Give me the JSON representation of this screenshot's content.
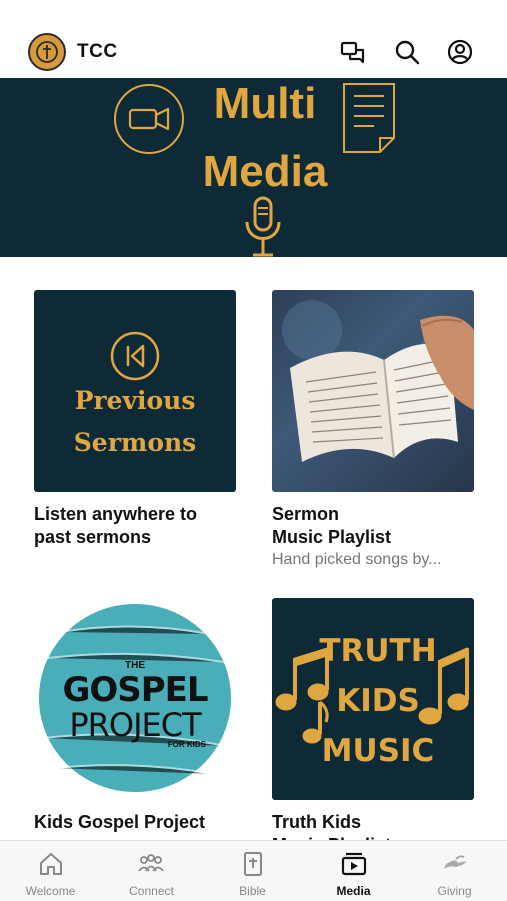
{
  "header": {
    "title": "TCC"
  },
  "banner": {
    "line1": "Multi",
    "line2": "Media"
  },
  "cards": [
    {
      "thumb_line1": "Previous",
      "thumb_line2": "Sermons",
      "title": "Listen anywhere to past sermons",
      "subtitle": ""
    },
    {
      "title_line1": "Sermon",
      "title_line2": "Music Playlist",
      "subtitle": "Hand picked songs by..."
    },
    {
      "logo_the": "THE",
      "logo_line1": "GOSPEL",
      "logo_line2": "PROJECT",
      "logo_kids": "FOR KIDS",
      "title": "Kids Gospel Project"
    },
    {
      "thumb_line1": "TRUTH",
      "thumb_line2": "KIDS",
      "thumb_line3": "MUSIC",
      "title_line1": "Truth Kids",
      "title_line2": "Music Playlist"
    }
  ],
  "tabs": [
    {
      "label": "Welcome",
      "icon": "home-icon"
    },
    {
      "label": "Connect",
      "icon": "people-icon"
    },
    {
      "label": "Bible",
      "icon": "bible-icon"
    },
    {
      "label": "Media",
      "icon": "media-icon",
      "active": true
    },
    {
      "label": "Giving",
      "icon": "giving-icon"
    }
  ],
  "colors": {
    "navy": "#0f2a37",
    "gold": "#e0a640",
    "teal": "#49aeb7"
  }
}
